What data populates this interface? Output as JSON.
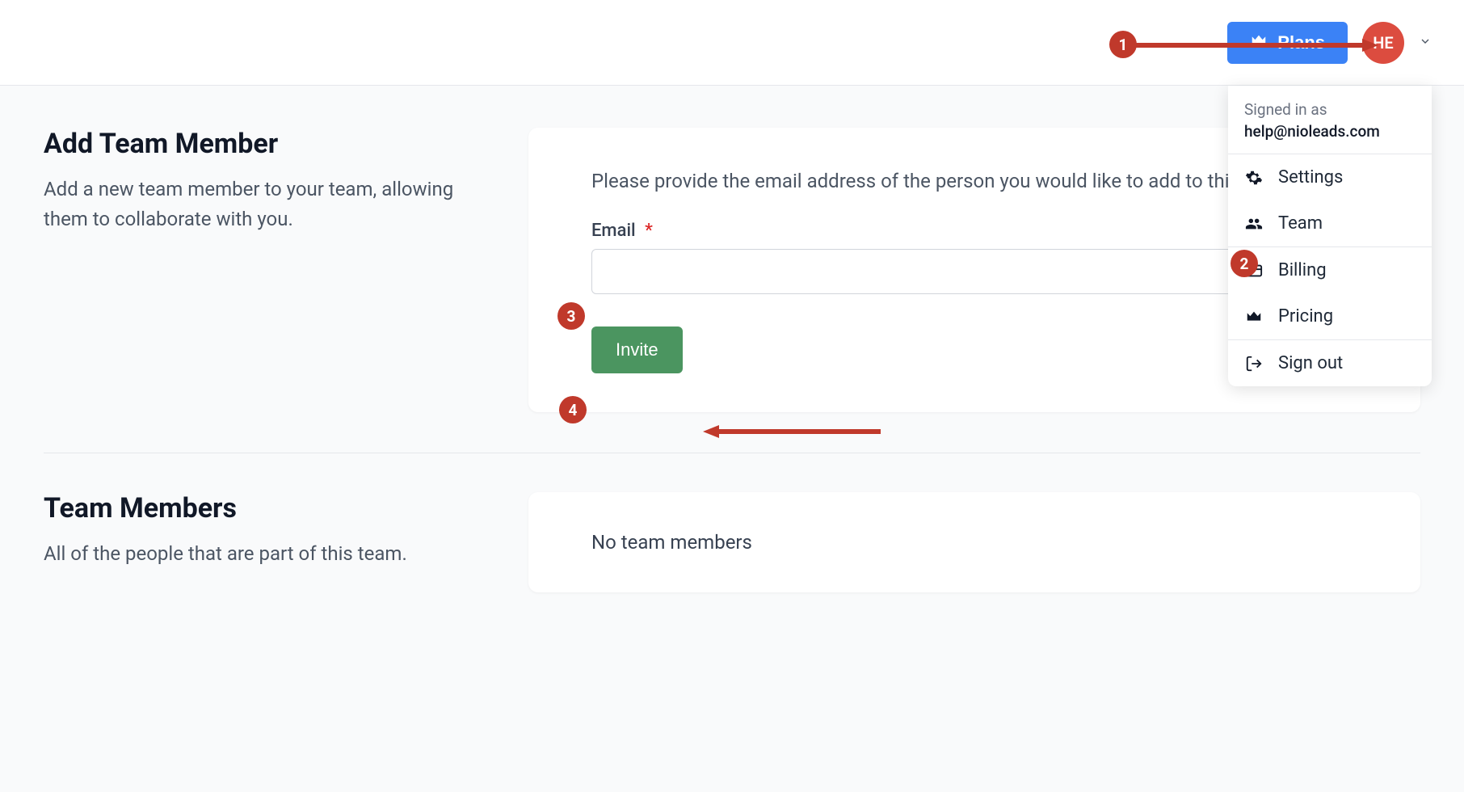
{
  "header": {
    "plans_label": "Plans",
    "avatar_initials": "HE"
  },
  "dropdown": {
    "signed_label": "Signed in as",
    "email": "help@nioleads.com",
    "items": {
      "settings": "Settings",
      "team": "Team",
      "billing": "Billing",
      "pricing": "Pricing",
      "signout": "Sign out"
    }
  },
  "section_add": {
    "title": "Add Team Member",
    "desc": "Add a new team member to your team, allowing them to collaborate with you.",
    "instruction": "Please provide the email address of the person you would like to add to this team.",
    "email_label": "Email",
    "required_mark": "*",
    "email_value": "",
    "invite_label": "Invite"
  },
  "section_members": {
    "title": "Team Members",
    "desc": "All of the people that are part of this team.",
    "empty": "No team members"
  },
  "annotations": {
    "b1": "1",
    "b2": "2",
    "b3": "3",
    "b4": "4"
  },
  "colors": {
    "primary_blue": "#3b82f6",
    "avatar_red": "#dc4c3f",
    "invite_green": "#4b9560",
    "annotation_red": "#c0392b"
  }
}
